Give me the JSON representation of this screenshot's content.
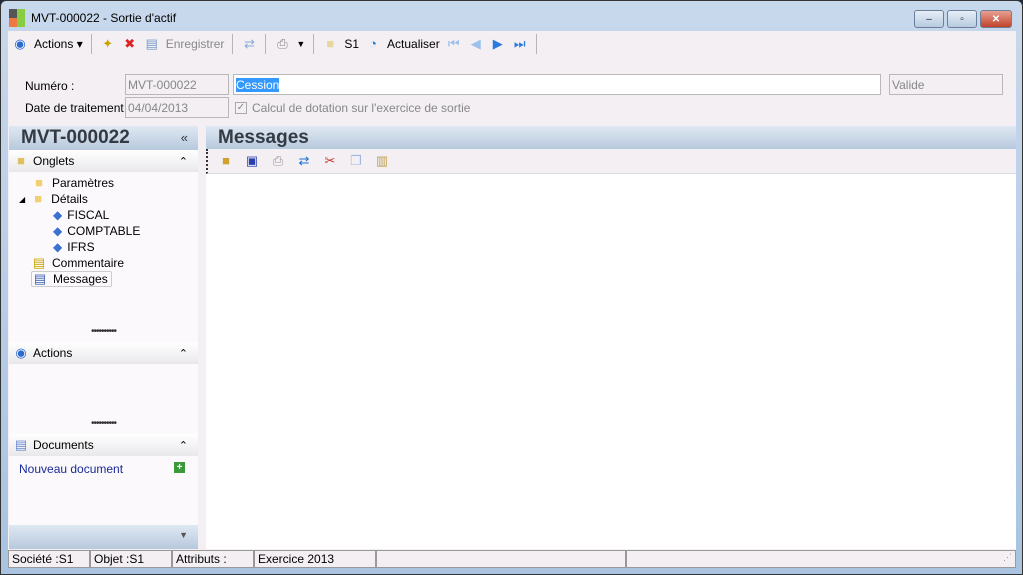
{
  "window": {
    "title": "MVT-000022 -  Sortie d'actif",
    "minimize": "–",
    "maximize": "▫",
    "close": "✕"
  },
  "toolbar": {
    "actions": "Actions",
    "save": "Enregistrer",
    "company": "S1",
    "refresh": "Actualiser"
  },
  "form": {
    "numero_label": "Numéro :",
    "numero": "MVT-000022",
    "libelle": "Cession",
    "statut": "Valide",
    "date_label": "Date de traitement :",
    "date": "04/04/2013",
    "checkbox_label": "Calcul de dotation sur l'exercice de sortie",
    "checkbox_checked": true
  },
  "left": {
    "header": "MVT-000022",
    "onglets": "Onglets",
    "tree": [
      "Paramètres",
      "Détails",
      "FISCAL",
      "COMPTABLE",
      "IFRS",
      "Commentaire",
      "Messages"
    ],
    "actions": "Actions",
    "documents": "Documents",
    "new_document": "Nouveau document"
  },
  "right": {
    "header": "Messages"
  },
  "status": [
    "Société :S1",
    "Objet :S1",
    "Attributs :",
    "Exercice 2013"
  ]
}
